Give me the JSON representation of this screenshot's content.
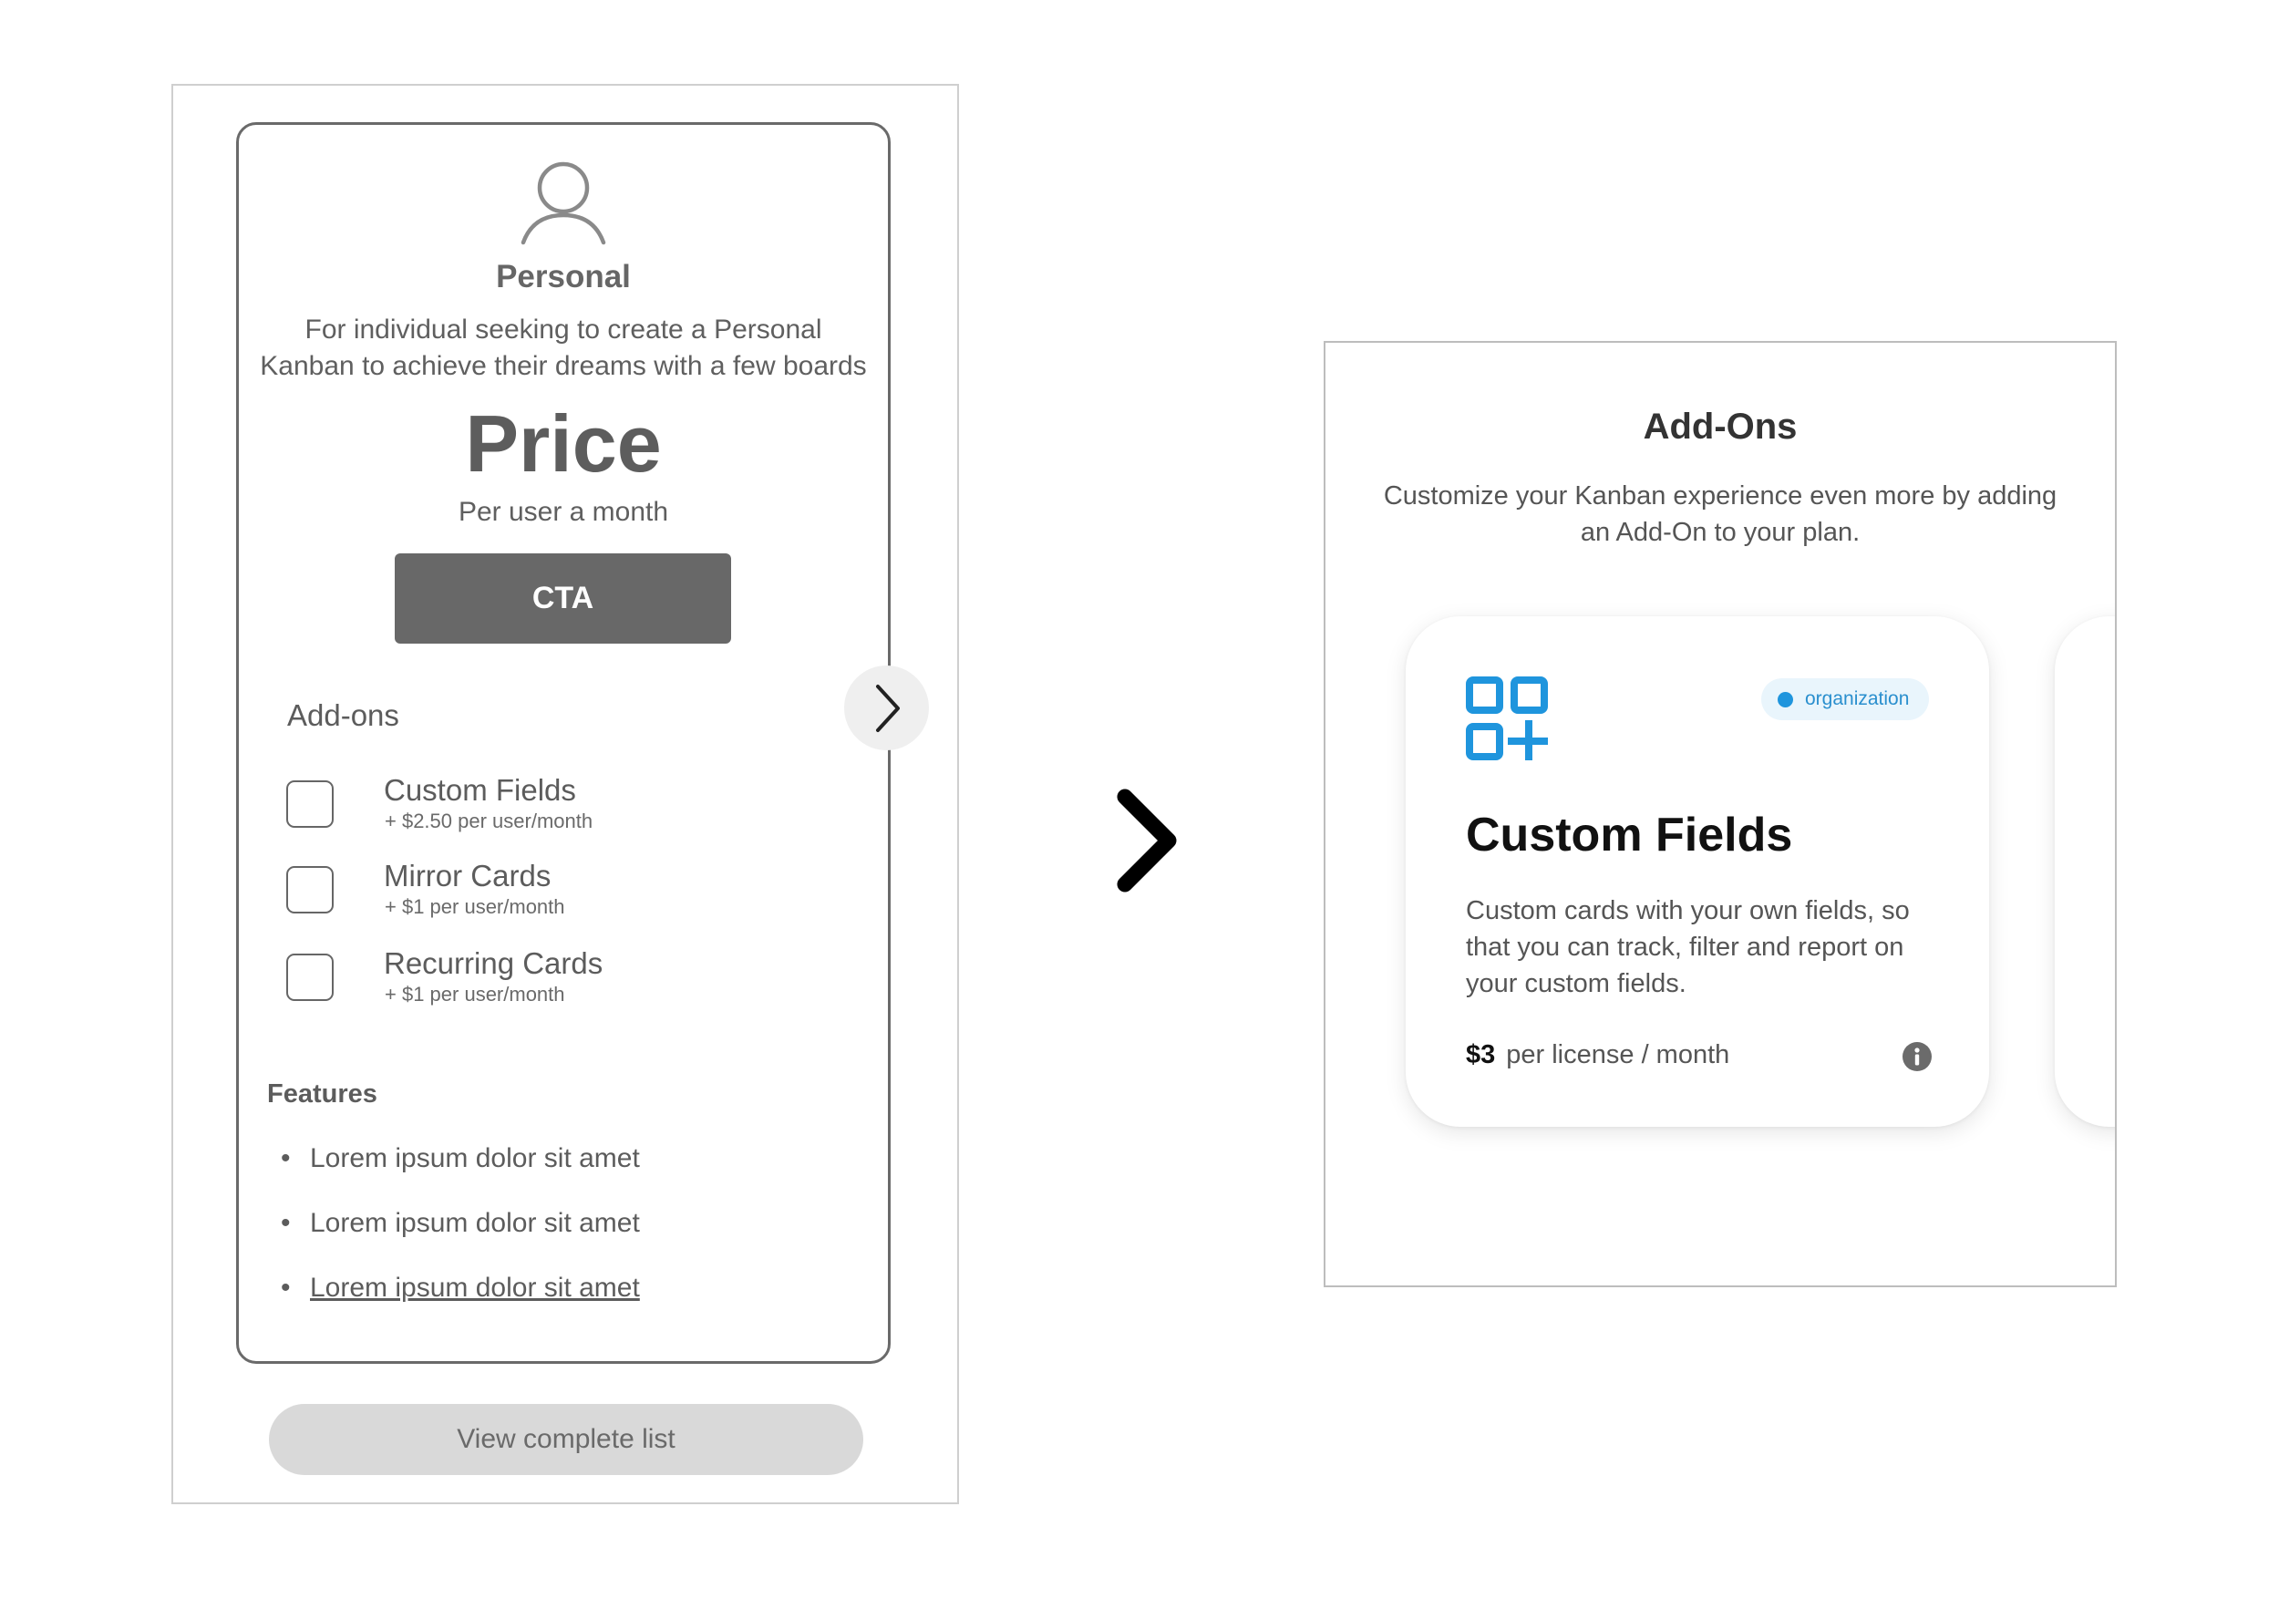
{
  "plan": {
    "name": "Personal",
    "description": "For individual seeking to create a Personal Kanban to achieve their dreams with a few boards",
    "price": "Price",
    "price_period": "Per user a month",
    "cta_label": "CTA",
    "user_icon": "user-icon"
  },
  "addons_section": {
    "heading": "Add-ons",
    "next_icon": "chevron-right-icon",
    "items": [
      {
        "name": "Custom Fields",
        "price": "+ $2.50 per user/month",
        "checked": false
      },
      {
        "name": "Mirror Cards",
        "price": "+ $1 per user/month",
        "checked": false
      },
      {
        "name": "Recurring Cards",
        "price": "+ $1 per user/month",
        "checked": false
      }
    ]
  },
  "features": {
    "heading": "Features",
    "items": [
      "Lorem ipsum dolor sit amet",
      "Lorem ipsum dolor sit amet",
      "Lorem ipsum dolor sit amet"
    ]
  },
  "view_complete_label": "View complete list",
  "flow_arrow_icon": "chevron-right-icon",
  "addons_panel": {
    "title": "Add-Ons",
    "description": "Customize your Kanban experience even more by adding an Add-On to your plan.",
    "card": {
      "icon": "grid-plus-icon",
      "badge": "organization",
      "title": "Custom Fields",
      "description": "Custom cards with your own fields, so that you can track, filter and report on your custom fields.",
      "price_amount": "$3",
      "price_unit": "per license / month",
      "info_icon": "info-icon"
    }
  },
  "colors": {
    "cta_bg": "#686868",
    "badge_blue": "#1f95dd",
    "icon_blue": "#1f95dd",
    "peek_teal": "#1ea38a",
    "view_button_bg": "#d9d9d9"
  }
}
